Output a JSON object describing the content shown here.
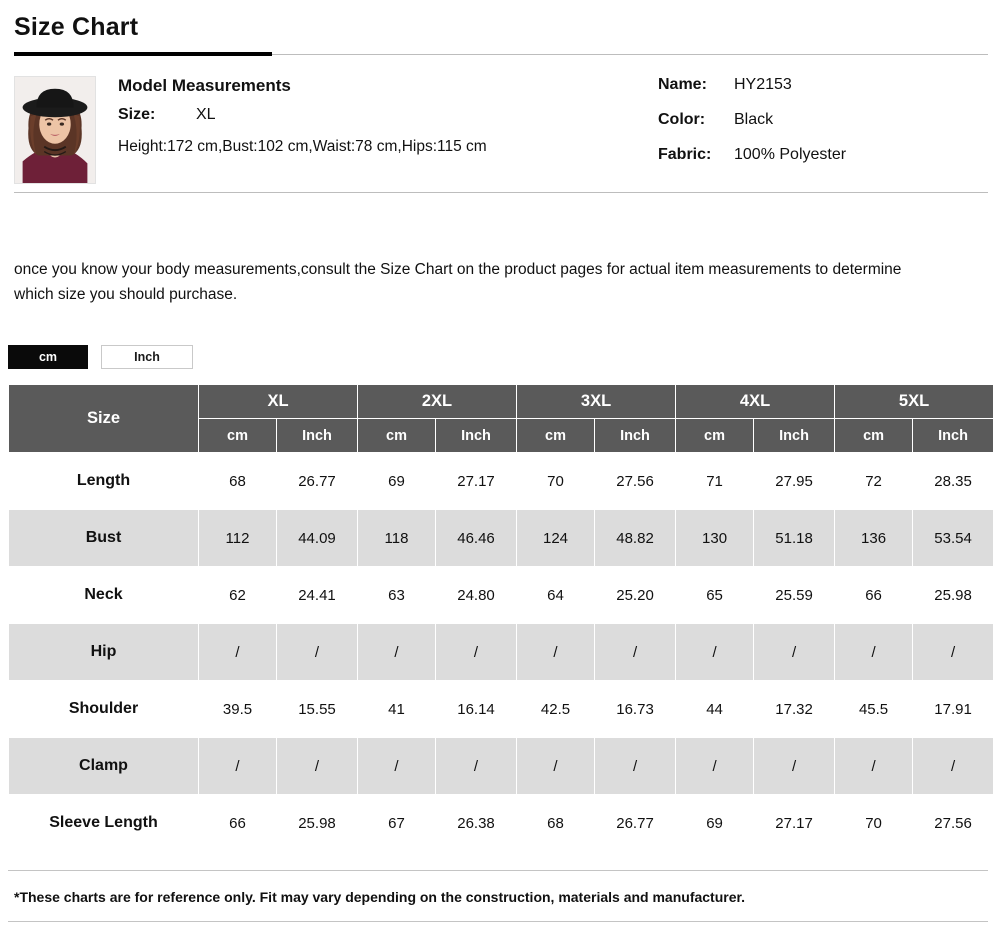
{
  "header": {
    "title": "Size Chart"
  },
  "model": {
    "photo_alt": "model-thumbnail",
    "heading": "Model Measurements",
    "size_label": "Size:",
    "size_value": "XL",
    "measurements_line": "Height:172 cm,Bust:102 cm,Waist:78 cm,Hips:115 cm",
    "name_label": "Name:",
    "name_value": "HY2153",
    "color_label": "Color:",
    "color_value": "Black",
    "fabric_label": "Fabric:",
    "fabric_value": "100% Polyester"
  },
  "intro": "once you know your body measurements,consult the Size Chart on the product pages for actual item measurements to determine which size you should purchase.",
  "unit_toggle": {
    "active": "cm",
    "options": [
      {
        "label": "cm",
        "active": true
      },
      {
        "label": "Inch",
        "active": false
      }
    ]
  },
  "table": {
    "corner_label": "Size",
    "sizes": [
      "XL",
      "2XL",
      "3XL",
      "4XL",
      "5XL"
    ],
    "unit_headers": [
      "cm",
      "Inch"
    ],
    "rows": [
      {
        "label": "Length",
        "band": "white",
        "values": [
          "68",
          "26.77",
          "69",
          "27.17",
          "70",
          "27.56",
          "71",
          "27.95",
          "72",
          "28.35"
        ]
      },
      {
        "label": "Bust",
        "band": "gray",
        "values": [
          "112",
          "44.09",
          "118",
          "46.46",
          "124",
          "48.82",
          "130",
          "51.18",
          "136",
          "53.54"
        ]
      },
      {
        "label": "Neck",
        "band": "white",
        "values": [
          "62",
          "24.41",
          "63",
          "24.80",
          "64",
          "25.20",
          "65",
          "25.59",
          "66",
          "25.98"
        ]
      },
      {
        "label": "Hip",
        "band": "gray",
        "values": [
          "/",
          "/",
          "/",
          "/",
          "/",
          "/",
          "/",
          "/",
          "/",
          "/"
        ]
      },
      {
        "label": "Shoulder",
        "band": "white",
        "values": [
          "39.5",
          "15.55",
          "41",
          "16.14",
          "42.5",
          "16.73",
          "44",
          "17.32",
          "45.5",
          "17.91"
        ]
      },
      {
        "label": "Clamp",
        "band": "gray",
        "values": [
          "/",
          "/",
          "/",
          "/",
          "/",
          "/",
          "/",
          "/",
          "/",
          "/"
        ]
      },
      {
        "label": "Sleeve Length",
        "band": "white",
        "values": [
          "66",
          "25.98",
          "67",
          "26.38",
          "68",
          "26.77",
          "69",
          "27.17",
          "70",
          "27.56"
        ]
      }
    ]
  },
  "footnote": "*These charts are for reference only. Fit may vary depending on the construction, materials and manufacturer.",
  "colors": {
    "header_gray": "#5a5a5a",
    "band_gray": "#dcdcdc",
    "accent_black": "#0a0a0a",
    "rule_gray": "#bdbdbd"
  }
}
